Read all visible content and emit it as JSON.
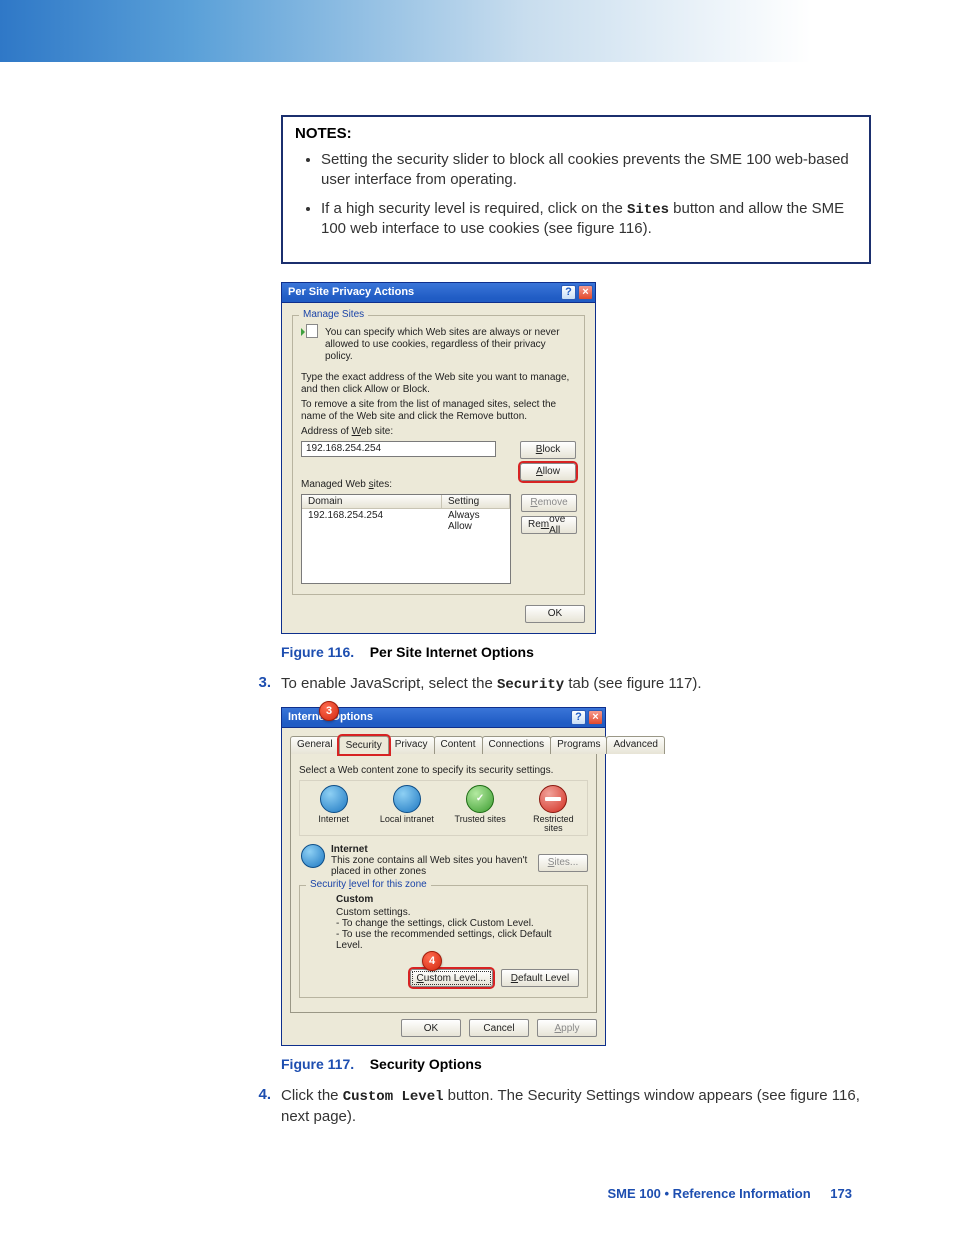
{
  "notes": {
    "title": "NOTES:",
    "items": [
      {
        "text": "Setting the security slider to block all cookies prevents the SME 100 web-based user interface from operating."
      },
      {
        "pre": "If a high security level is required, click on the ",
        "mono": "Sites",
        "post": " button and allow the SME 100 web interface to use cookies (see figure 116)."
      }
    ]
  },
  "dlg116": {
    "title": "Per Site Privacy Actions",
    "group_legend": "Manage Sites",
    "intro": "You can specify which Web sites are always or never allowed to use cookies, regardless of their privacy policy.",
    "instr1": "Type the exact address of the Web site you want to manage, and then click Allow or Block.",
    "instr2": "To remove a site from the list of managed sites, select the name of the Web site and click the Remove button.",
    "addr_label": "Address of Web site:",
    "addr_value": "192.168.254.254",
    "block": "Block",
    "allow": "Allow",
    "managed_label": "Managed Web sites:",
    "col_domain": "Domain",
    "col_setting": "Setting",
    "row_domain": "192.168.254.254",
    "row_setting": "Always Allow",
    "remove": "Remove",
    "remove_all": "Remove All",
    "ok": "OK"
  },
  "cap116": {
    "fig": "Figure 116.",
    "txt": "Per Site Internet Options"
  },
  "step3": {
    "num": "3.",
    "pre": "To enable JavaScript, select the ",
    "mono": "Security",
    "post": " tab (see figure 117)."
  },
  "dlg117": {
    "title": "Internet Options",
    "bubble3": "3",
    "tabs": {
      "general": "General",
      "security": "Security",
      "privacy": "Privacy",
      "content": "Content",
      "connections": "Connections",
      "programs": "Programs",
      "advanced": "Advanced"
    },
    "zone_prompt": "Select a Web content zone to specify its security settings.",
    "zones": {
      "internet": "Internet",
      "local": "Local intranet",
      "trusted": "Trusted sites",
      "restricted": "Restricted sites"
    },
    "zone_name": "Internet",
    "zone_desc": "This zone contains all Web sites you haven't placed in other zones",
    "sites": "Sites...",
    "seclvl_legend": "Security level for this zone",
    "custom_title": "Custom",
    "custom_l1": "Custom settings.",
    "custom_l2": "- To change the settings, click Custom Level.",
    "custom_l3": "- To use the recommended settings, click Default Level.",
    "bubble4": "4",
    "custom_level": "Custom Level...",
    "default_level": "Default Level",
    "ok": "OK",
    "cancel": "Cancel",
    "apply": "Apply"
  },
  "cap117": {
    "fig": "Figure 117.",
    "txt": "Security Options"
  },
  "step4": {
    "num": "4.",
    "pre": "Click the ",
    "mono": "Custom Level",
    "post": " button. The Security Settings window appears (see figure 116, next page)."
  },
  "footer": {
    "text": "SME 100 • Reference Information",
    "page": "173"
  }
}
